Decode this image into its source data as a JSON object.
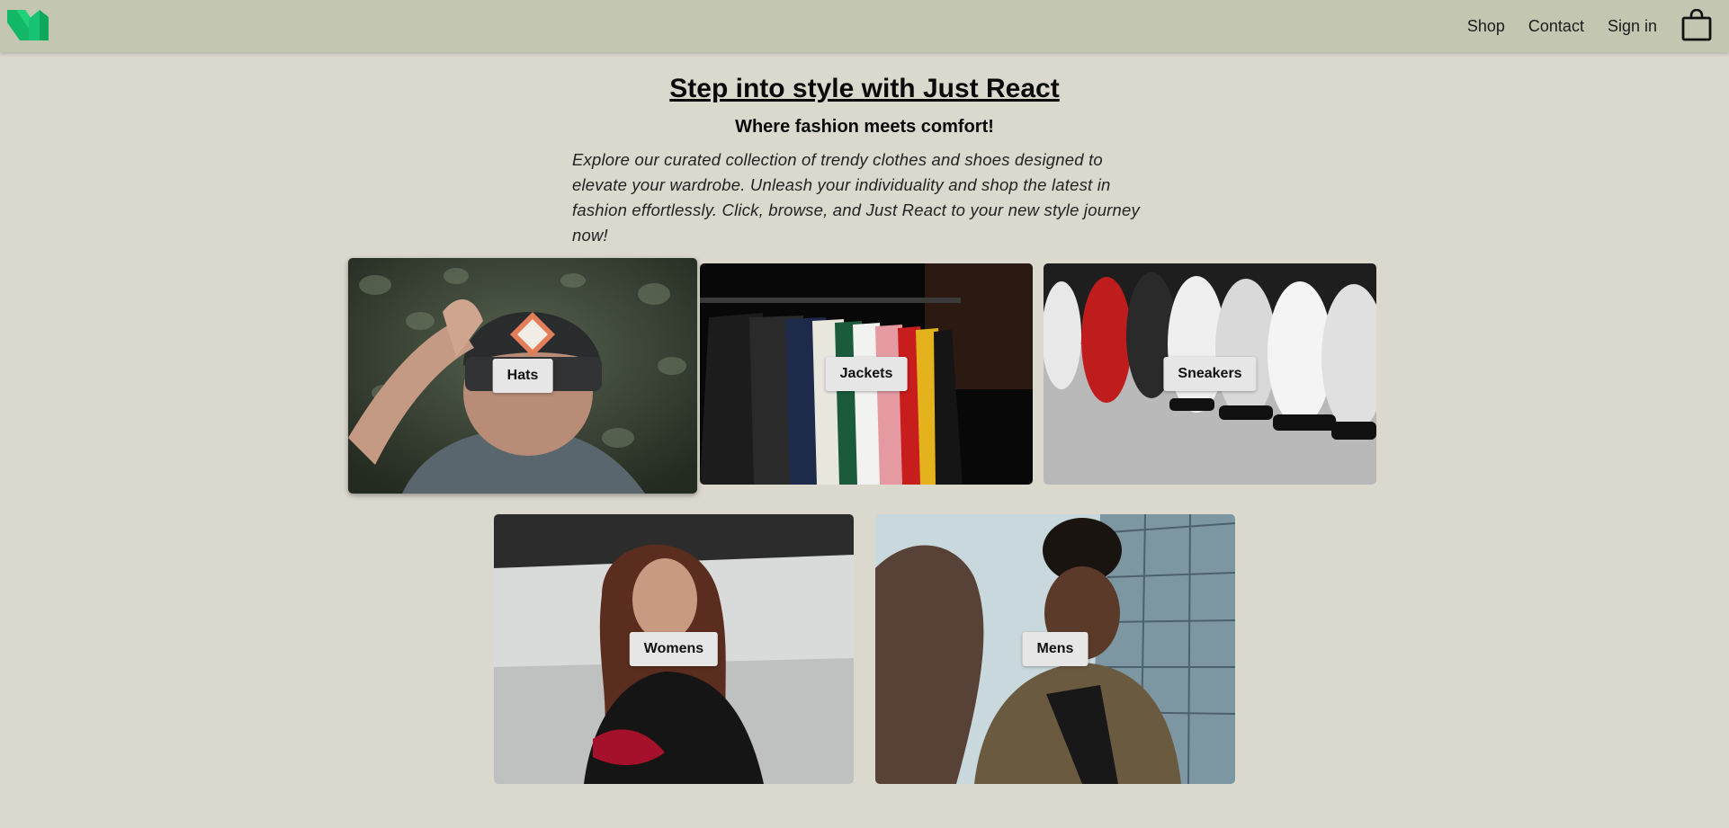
{
  "nav": {
    "logo": "medium-m-logo",
    "links": [
      "Shop",
      "Contact",
      "Sign in"
    ],
    "bag_icon": "shopping-bag-icon"
  },
  "hero": {
    "title": "Step into style with Just React",
    "subtitle": "Where fashion meets comfort!",
    "description": "Explore our curated collection of trendy clothes and shoes designed to elevate your wardrobe. Unleash your individuality and shop the latest in fashion effortlessly. Click, browse, and Just React to your new style journey now!"
  },
  "categories": [
    {
      "label": "Hats"
    },
    {
      "label": "Jackets"
    },
    {
      "label": "Sneakers"
    },
    {
      "label": "Womens"
    },
    {
      "label": "Mens"
    }
  ],
  "colors": {
    "page_bg": "#dbd9cd",
    "navbar_bg": "#c3c7b1",
    "logo_green": "#1fd27a",
    "label_bg": "#e6e6e6"
  }
}
